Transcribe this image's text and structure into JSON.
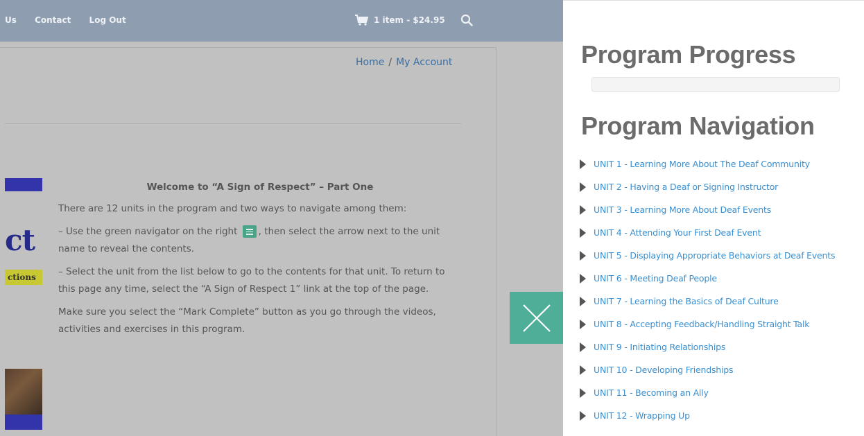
{
  "topbar": {
    "nav": [
      "Us",
      "Contact",
      "Log Out"
    ],
    "cart_label": "1 item - $24.95"
  },
  "breadcrumb": {
    "home": "Home",
    "separator": "/",
    "current": "My Account"
  },
  "image_fragment": {
    "title_fragment": "ct",
    "label_fragment": "ctions"
  },
  "welcome": {
    "heading": "Welcome to “A Sign of Respect” – Part One",
    "intro": "There are 12 units in the program and two ways to navigate among them:",
    "step1_before": "– Use the green navigator on the right",
    "step1_after": ", then select the arrow next to the unit name to reveal the contents.",
    "step2": "– Select the unit from the list below to go to the contents for that unit.  To return to this page any time, select the “A Sign of Respect 1” link at the top of the page.",
    "note": "Make sure you select the “Mark Complete” button as you go through the videos, activities and exercises in this program."
  },
  "panel": {
    "progress_title": "Program Progress",
    "progress_value": 0,
    "navigation_title": "Program Navigation",
    "units": [
      "UNIT 1 - Learning More About The Deaf Community",
      "UNIT 2 - Having a Deaf or Signing Instructor",
      "UNIT 3 - Learning More About Deaf Events",
      "UNIT 4 - Attending Your First Deaf Event",
      "UNIT 5 - Displaying Appropriate Behaviors at Deaf Events",
      "UNIT 6 - Meeting Deaf People",
      "UNIT 7 - Learning the Basics of Deaf Culture",
      "UNIT 8 - Accepting Feedback/Handling Straight Talk",
      "UNIT 9 - Initiating Relationships",
      "UNIT 10 - Developing Friendships",
      "UNIT 11 - Becoming an Ally",
      "UNIT 12 - Wrapping Up"
    ]
  },
  "colors": {
    "accent": "#4fae98",
    "link": "#3a8fd0",
    "overlay": "#c1c1c1",
    "topbar": "#8f9db0"
  },
  "icons": [
    "cart-icon",
    "search-icon",
    "close-icon",
    "navigator-icon",
    "caret-right-icon"
  ]
}
